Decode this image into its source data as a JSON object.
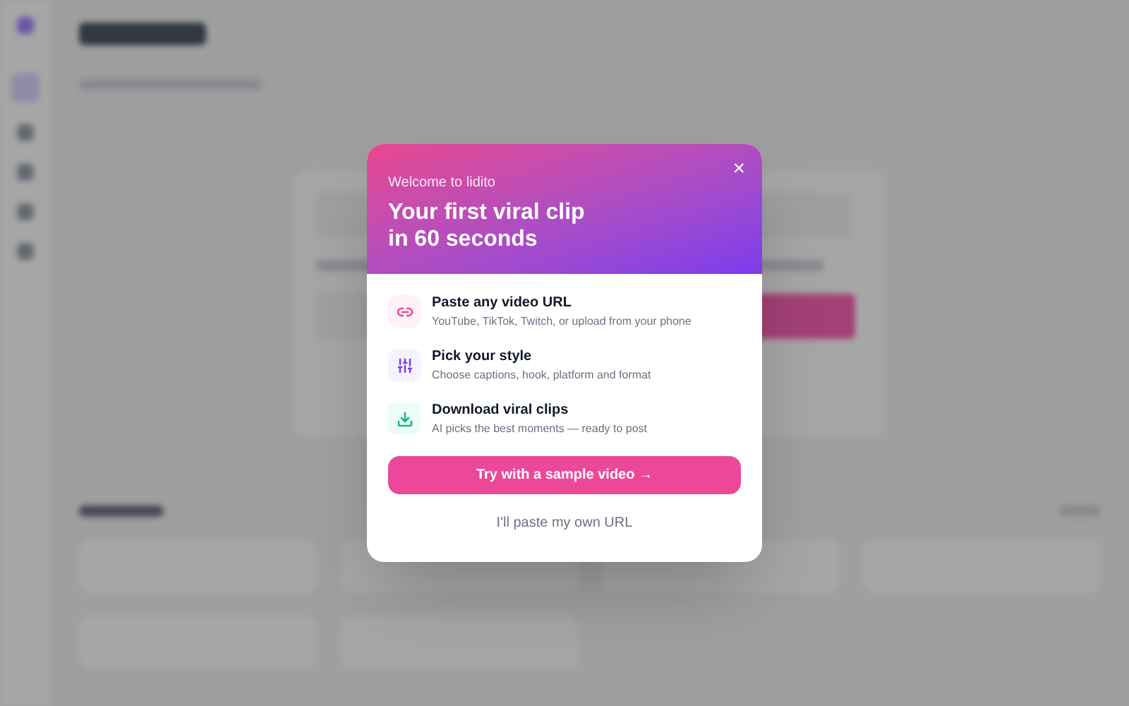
{
  "dialog": {
    "eyebrow": "Welcome to lidito",
    "title": "Your first viral clip in 60 seconds",
    "close": "×",
    "steps": [
      {
        "kind": "link",
        "title": "Paste any video URL",
        "subtitle": "YouTube, TikTok, Twitch, or upload from your phone",
        "color": "#ec4899"
      },
      {
        "kind": "sliders",
        "title": "Pick your style",
        "subtitle": "Choose captions, hook, platform and format",
        "color": "#7c3aed"
      },
      {
        "kind": "download",
        "title": "Download viral clips",
        "subtitle": "AI picks the best moments — ready to post",
        "color": "#10b981"
      }
    ],
    "primary": "Try with a sample video →",
    "secondary": "I'll paste my own URL"
  }
}
